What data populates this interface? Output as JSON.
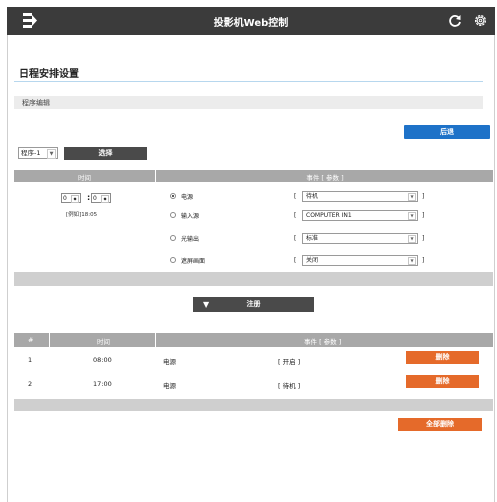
{
  "header": {
    "title": "投影机Web控制",
    "menu_icon": "menu-icon",
    "refresh_icon": "refresh-icon",
    "settings_icon": "gear-icon"
  },
  "page": {
    "title": "日程安排设置",
    "section_label": "程序编辑",
    "back_button": "后退"
  },
  "program": {
    "select_value": "程序-1",
    "select_button": "选择"
  },
  "editor": {
    "col_time": "时间",
    "col_event": "事件 [ 参数 ]",
    "hour_value": "0",
    "minute_value": "0",
    "time_separator": ":",
    "example": "[例如]18:05",
    "events": [
      {
        "label": "电源",
        "value": "待机",
        "selected": true
      },
      {
        "label": "输入源",
        "value": "COMPUTER IN1",
        "selected": false
      },
      {
        "label": "光输出",
        "value": "标准",
        "selected": false
      },
      {
        "label": "遮屏画面",
        "value": "关闭",
        "selected": false
      }
    ],
    "bracket_open": "[",
    "bracket_close": "]"
  },
  "register_button": "注册",
  "list": {
    "col_num": "#",
    "col_time": "时间",
    "col_event": "事件 [ 参数 ]",
    "rows": [
      {
        "num": "1",
        "time": "08:00",
        "event": "电源",
        "param": "[ 开启 ]",
        "delete": "删除"
      },
      {
        "num": "2",
        "time": "17:00",
        "event": "电源",
        "param": "[ 待机 ]",
        "delete": "删除"
      }
    ],
    "delete_all": "全部删除"
  },
  "colors": {
    "topbar": "#3b3b3b",
    "blue": "#1e72c8",
    "orange": "#e56a2a",
    "table_header": "#a8a8a8"
  }
}
